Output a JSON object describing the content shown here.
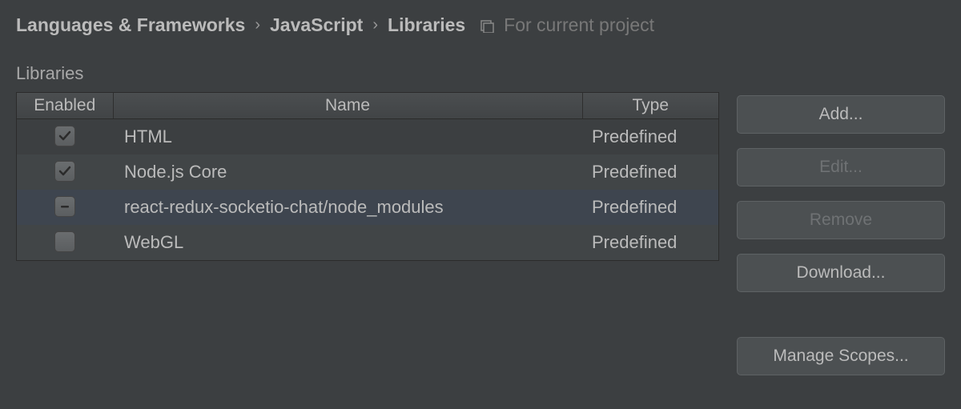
{
  "breadcrumb": {
    "item1": "Languages & Frameworks",
    "item2": "JavaScript",
    "item3": "Libraries",
    "scope_hint": "For current project"
  },
  "section": {
    "label": "Libraries"
  },
  "table": {
    "headers": {
      "enabled": "Enabled",
      "name": "Name",
      "type": "Type"
    },
    "rows": [
      {
        "name": "HTML",
        "type": "Predefined",
        "enabled": "checked"
      },
      {
        "name": "Node.js Core",
        "type": "Predefined",
        "enabled": "checked"
      },
      {
        "name": "react-redux-socketio-chat/node_modules",
        "type": "Predefined",
        "enabled": "indeterminate"
      },
      {
        "name": "WebGL",
        "type": "Predefined",
        "enabled": "unchecked"
      }
    ]
  },
  "buttons": {
    "add": "Add...",
    "edit": "Edit...",
    "remove": "Remove",
    "download": "Download...",
    "manage_scopes": "Manage Scopes..."
  }
}
